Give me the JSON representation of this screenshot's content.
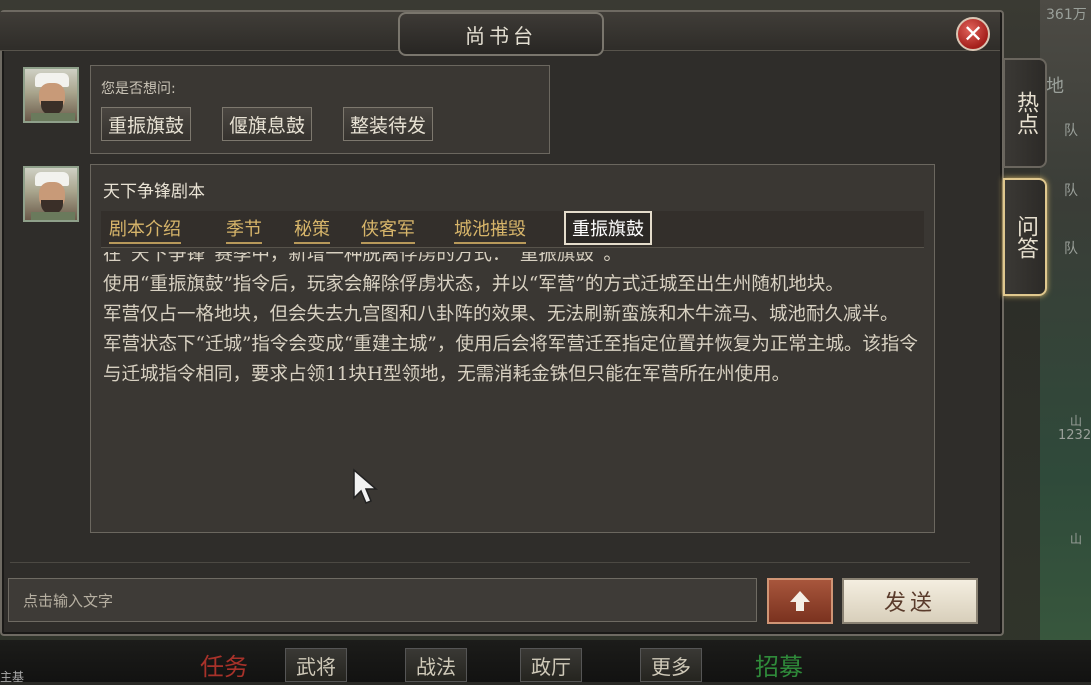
{
  "window": {
    "title": "尚书台"
  },
  "background": {
    "top_right_text": "361万",
    "right_labels": [
      "地",
      "队",
      "队",
      "队",
      "山",
      "1232",
      "山"
    ],
    "bottom_tabs": [
      "任务",
      "武将",
      "战法",
      "政厅",
      "更多",
      "招募"
    ],
    "bottom_left_text": "主基"
  },
  "side_tabs": [
    {
      "label": "热点",
      "active": false
    },
    {
      "label": "问答",
      "active": true
    }
  ],
  "suggest": {
    "label": "您是否想问:",
    "options": [
      "重振旗鼓",
      "偃旗息鼓",
      "整装待发"
    ]
  },
  "answer": {
    "title": "天下争锋剧本",
    "tabs": [
      "剧本介绍",
      "季节",
      "秘策",
      "侠客军",
      "城池摧毁",
      "重振旗鼓"
    ],
    "active_tab": "重振旗鼓",
    "paragraphs": [
      "在“天下争锋”赛季中，新增一种脱离俘虏的方式：“重振旗鼓”。",
      "使用“重振旗鼓”指令后，玩家会解除俘虏状态，并以“军营”的方式迁城至出生州随机地块。",
      "军营仅占一格地块，但会失去九宫图和八卦阵的效果、无法刷新蛮族和木牛流马、城池耐久减半。",
      "军营状态下“迁城”指令会变成“重建主城”，使用后会将军营迁至指定位置并恢复为正常主城。该指令与迁城指令相同，要求占领11块H型领地，无需消耗金铢但只能在军营所在州使用。"
    ]
  },
  "input": {
    "placeholder": "点击输入文字"
  },
  "send_label": "发送",
  "icons": {
    "close": "close-icon",
    "upload": "arrow-up-icon",
    "cursor": "mouse-pointer-icon"
  }
}
